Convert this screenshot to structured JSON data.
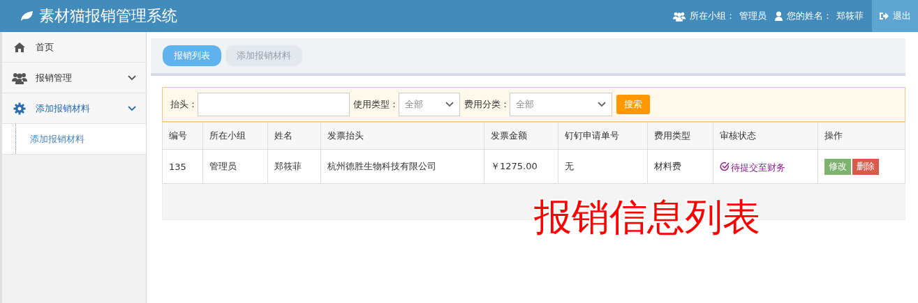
{
  "header": {
    "title": "素材猫报销管理系统",
    "group_label": "所在小组：",
    "group": "管理员",
    "name_label": "您的姓名：",
    "name": "郑筱菲",
    "logout": "退出"
  },
  "sidebar": {
    "items": [
      {
        "kind": "link",
        "label": "首页",
        "selected": false
      },
      {
        "kind": "group",
        "label": "报销管理",
        "selected": false
      },
      {
        "kind": "group",
        "label": "添加报销材料",
        "selected": true,
        "children": [
          {
            "label": "添加报销材料",
            "selected": true
          }
        ]
      }
    ]
  },
  "tabs": [
    {
      "label": "报销列表",
      "selected": true
    },
    {
      "label": "添加报销材料",
      "selected": false
    }
  ],
  "filter": {
    "title_label": "抬头：",
    "usage_label": "使用类型：",
    "usage_value": "全部",
    "category_label": "费用分类：",
    "category_value": "全部",
    "search_button": "搜索"
  },
  "table": {
    "columns": [
      "编号",
      "所在小组",
      "姓名",
      "发票抬头",
      "发票金额",
      "钉钉申请单号",
      "费用类型",
      "审核状态",
      "操作"
    ],
    "rows": [
      {
        "cells": [
          "135",
          "管理员",
          "郑筱菲",
          "杭州德胜生物科技有限公司",
          "￥1275.00",
          "无",
          "材料费"
        ],
        "status": "待提交至财务",
        "color": "#8b1c8e",
        "actions": [
          {
            "kind": "edit",
            "label": "修改"
          },
          {
            "kind": "delete",
            "label": "删除"
          }
        ]
      }
    ]
  },
  "annotation": "报销信息列表"
}
